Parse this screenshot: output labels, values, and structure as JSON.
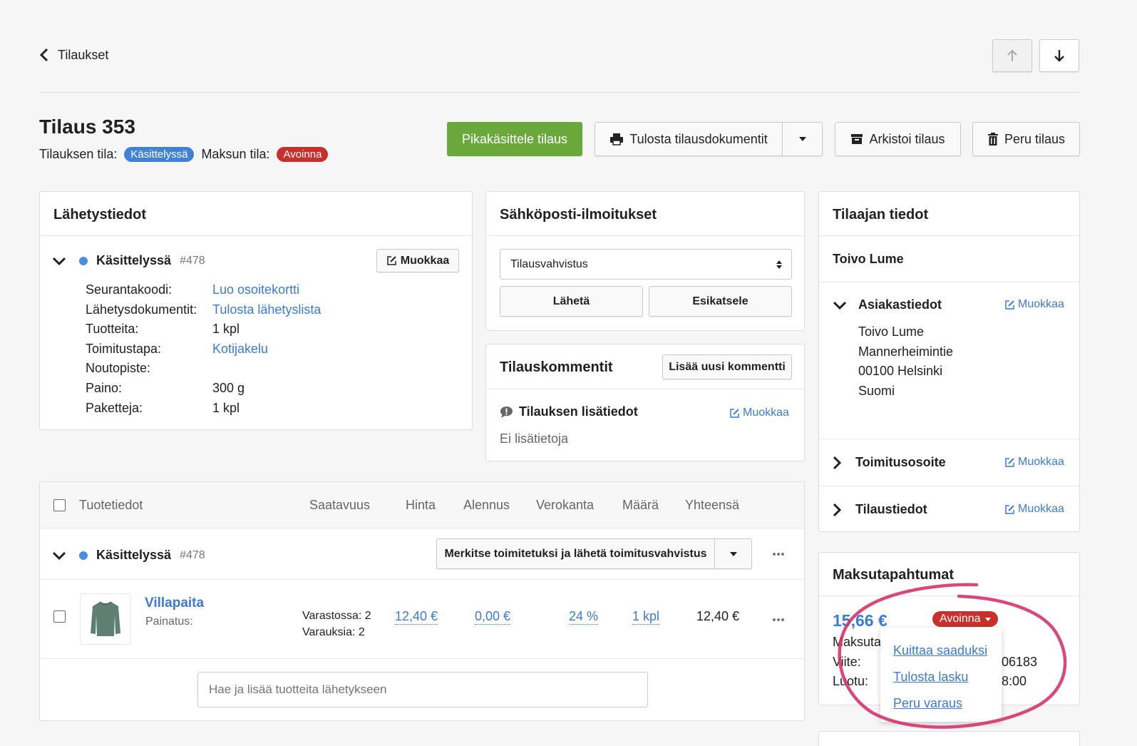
{
  "nav": {
    "back_label": "Tilaukset"
  },
  "order": {
    "title": "Tilaus 353",
    "order_state_label": "Tilauksen tila:",
    "order_state_badge": "Käsittelyssä",
    "payment_state_label": "Maksun tila:",
    "payment_state_badge": "Avoinna"
  },
  "actions": {
    "quick_process": "Pikakäsittele tilaus",
    "print_docs": "Tulosta tilausdokumentit",
    "archive": "Arkistoi tilaus",
    "cancel": "Peru tilaus"
  },
  "shipping": {
    "title": "Lähetystiedot",
    "status": "Käsittelyssä",
    "number": "#478",
    "edit": "Muokkaa",
    "rows": [
      {
        "label": "Seurantakoodi:",
        "value": "Luo osoitekortti"
      },
      {
        "label": "Lähetysdokumentit:",
        "value": "Tulosta lähetyslista"
      },
      {
        "label": "Tuotteita:",
        "value": "1 kpl"
      },
      {
        "label": "Toimitustapa:",
        "value": "Kotijakelu"
      },
      {
        "label": "Noutopiste:",
        "value": ""
      },
      {
        "label": "Paino:",
        "value": "300 g"
      },
      {
        "label": "Paketteja:",
        "value": "1 kpl"
      }
    ]
  },
  "email": {
    "title": "Sähköposti-ilmoitukset",
    "select_value": "Tilausvahvistus",
    "send": "Lähetä",
    "preview": "Esikatsele"
  },
  "comments": {
    "title": "Tilauskommentit",
    "add": "Lisää uusi kommentti",
    "info_title": "Tilauksen lisätiedot",
    "edit": "Muokkaa",
    "empty": "Ei lisätietoja"
  },
  "customer": {
    "title": "Tilaajan tiedot",
    "name": "Toivo Lume",
    "details_title": "Asiakastiedot",
    "edit": "Muokkaa",
    "address": [
      "Toivo Lume",
      "Mannerheimintie",
      "00100 Helsinki",
      "Suomi"
    ],
    "delivery_title": "Toimitusosoite",
    "order_info_title": "Tilaustiedot"
  },
  "products": {
    "headers": {
      "info": "Tuotetiedot",
      "availability": "Saatavuus",
      "price": "Hinta",
      "discount": "Alennus",
      "tax": "Verokanta",
      "qty": "Määrä",
      "total": "Yhteensä"
    },
    "group_status": "Käsittelyssä",
    "group_number": "#478",
    "mark_delivered": "Merkitse toimitetuksi ja lähetä toimitusvahvistus",
    "item": {
      "name": "Villapaita",
      "print_label": "Painatus:",
      "stock": "Varastossa: 2",
      "reserved": "Varauksia: 2",
      "price": "12,40 €",
      "discount": "0,00 €",
      "tax": "24 %",
      "qty": "1 kpl",
      "total": "12,40 €"
    },
    "search_placeholder": "Hae ja lisää tuotteita lähetykseen"
  },
  "payments": {
    "title": "Maksutapahtumat",
    "amount": "15,66 €",
    "badge": "Avoinna",
    "label1": "Maksuta",
    "label2": "Viite:",
    "label3": "Luotu:",
    "value2": "06183",
    "value3": "8:00",
    "menu": [
      "Kuittaa saaduksi",
      "Tulosta lasku",
      "Peru varaus"
    ]
  },
  "colors": {
    "accent_blue": "#3a7bd5",
    "badge_blue": "#3f82d8",
    "badge_red": "#c9302c",
    "green": "#6aa83c",
    "annotation": "#d6336c"
  }
}
